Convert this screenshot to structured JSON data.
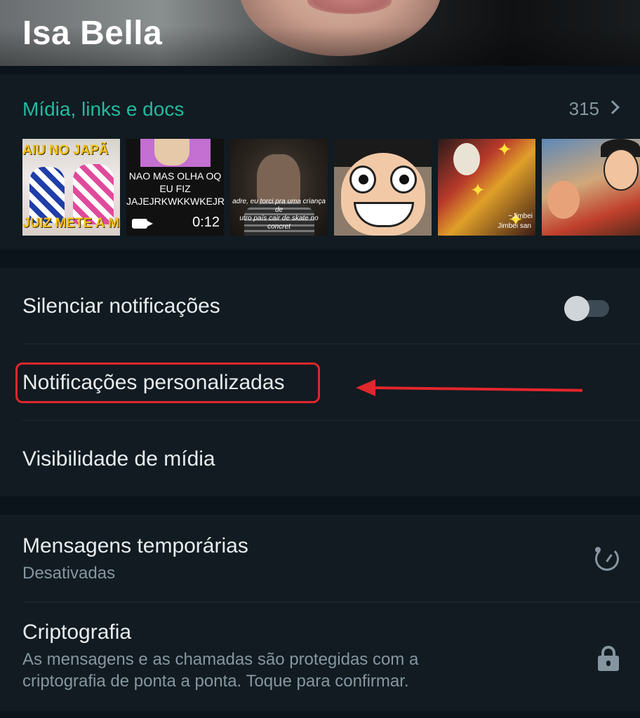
{
  "header": {
    "contact_name": "Isa Bella"
  },
  "media": {
    "title": "Mídia, links e docs",
    "count": "315",
    "thumbnails": [
      {
        "top_text": "AIU NO JAPÃ",
        "bottom_text": "JUIZ METE A MÃ"
      },
      {
        "caption": "NAO MAS OLHA OQ EU FIZ JAJEJRKWKKWKEJRJQ",
        "duration": "0:12",
        "icon": "video-camera-icon"
      },
      {
        "subtitle": "adre, eu torci pra uma criança de\nutro país cair de skate no concret"
      },
      {},
      {
        "caption_1": "~Jimbei",
        "caption_2": "Jimbei san"
      },
      {}
    ]
  },
  "settings": {
    "mute_label": "Silenciar notificações",
    "mute_enabled": false,
    "custom_notifications_label": "Notificações personalizadas",
    "media_visibility_label": "Visibilidade de mídia",
    "disappearing_label": "Mensagens temporárias",
    "disappearing_status": "Desativadas",
    "encryption_label": "Criptografia",
    "encryption_desc_1": "As mensagens e as chamadas são protegidas com a",
    "encryption_desc_2": "criptografia de ponta a ponta. Toque para confirmar."
  },
  "annotation": {
    "color": "#e1262c"
  },
  "colors": {
    "accent": "#25b9a0",
    "background": "#0b141a",
    "card": "#111b21",
    "secondary_text": "#8696a0"
  }
}
